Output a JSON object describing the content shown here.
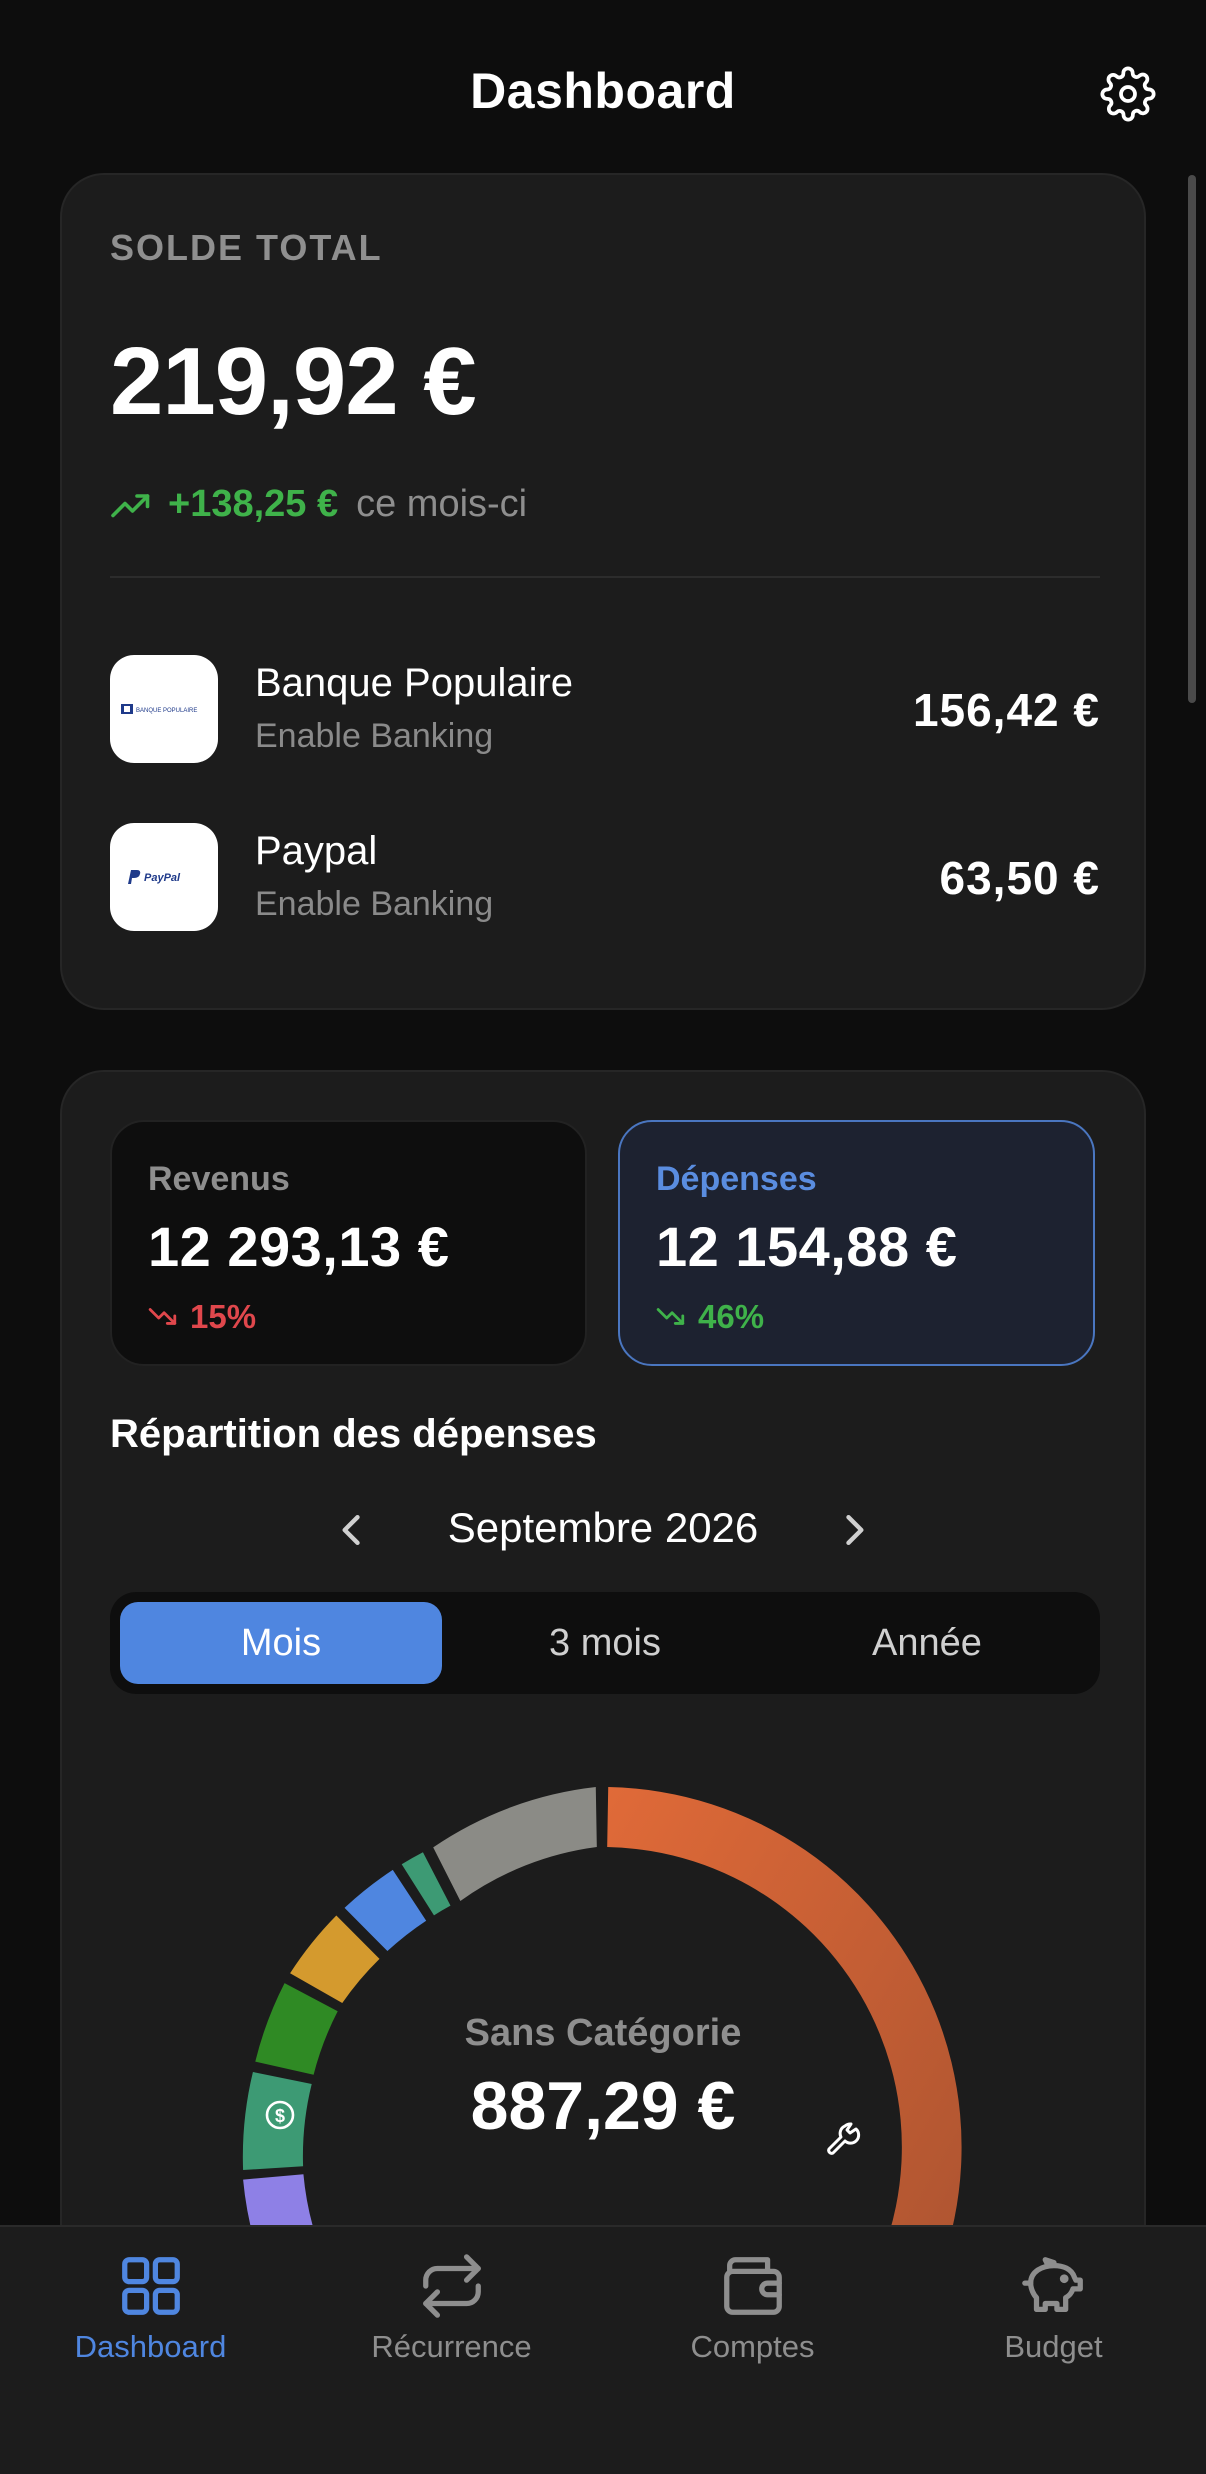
{
  "header": {
    "title": "Dashboard",
    "settings_icon": "gear-icon"
  },
  "balance": {
    "label": "SOLDE TOTAL",
    "total": "219,92 €",
    "trend_amount": "+138,25 €",
    "trend_suffix": "ce mois-ci",
    "trend_icon": "trend-up-icon",
    "accounts": [
      {
        "name": "Banque Populaire",
        "provider": "Enable Banking",
        "amount": "156,42 €",
        "logo_text": "BANQUE POPULAIRE"
      },
      {
        "name": "Paypal",
        "provider": "Enable Banking",
        "amount": "63,50 €",
        "logo_text": "PayPal"
      }
    ]
  },
  "stats": {
    "revenus": {
      "label": "Revenus",
      "value": "12 293,13 €",
      "change": "15%",
      "direction": "down",
      "color": "#e0474c"
    },
    "depenses": {
      "label": "Dépenses",
      "value": "12 154,88 €",
      "change": "46%",
      "direction": "down",
      "color": "#3fb24a"
    }
  },
  "breakdown": {
    "title": "Répartition des dépenses",
    "period": "Septembre 2026",
    "segments": [
      "Mois",
      "3 mois",
      "Année"
    ],
    "active_segment": "Mois",
    "center_label": "Sans Catégorie",
    "center_value": "887,29 €",
    "category_colors": [
      "#d4693a",
      "#8e80e6",
      "#3d9a74",
      "#2f8a24",
      "#d49a2e",
      "#4f86e0",
      "#3d9a74",
      "#8b8b86"
    ]
  },
  "tabs": [
    {
      "label": "Dashboard",
      "icon": "grid-icon",
      "active": true
    },
    {
      "label": "Récurrence",
      "icon": "repeat-icon",
      "active": false
    },
    {
      "label": "Comptes",
      "icon": "wallet-icon",
      "active": false
    },
    {
      "label": "Budget",
      "icon": "piggy-bank-icon",
      "active": false
    }
  ],
  "colors": {
    "accent": "#4f86e0",
    "positive": "#3fb24a",
    "negative": "#e0474c",
    "background": "#0d0d0d",
    "card": "#1c1c1c"
  }
}
